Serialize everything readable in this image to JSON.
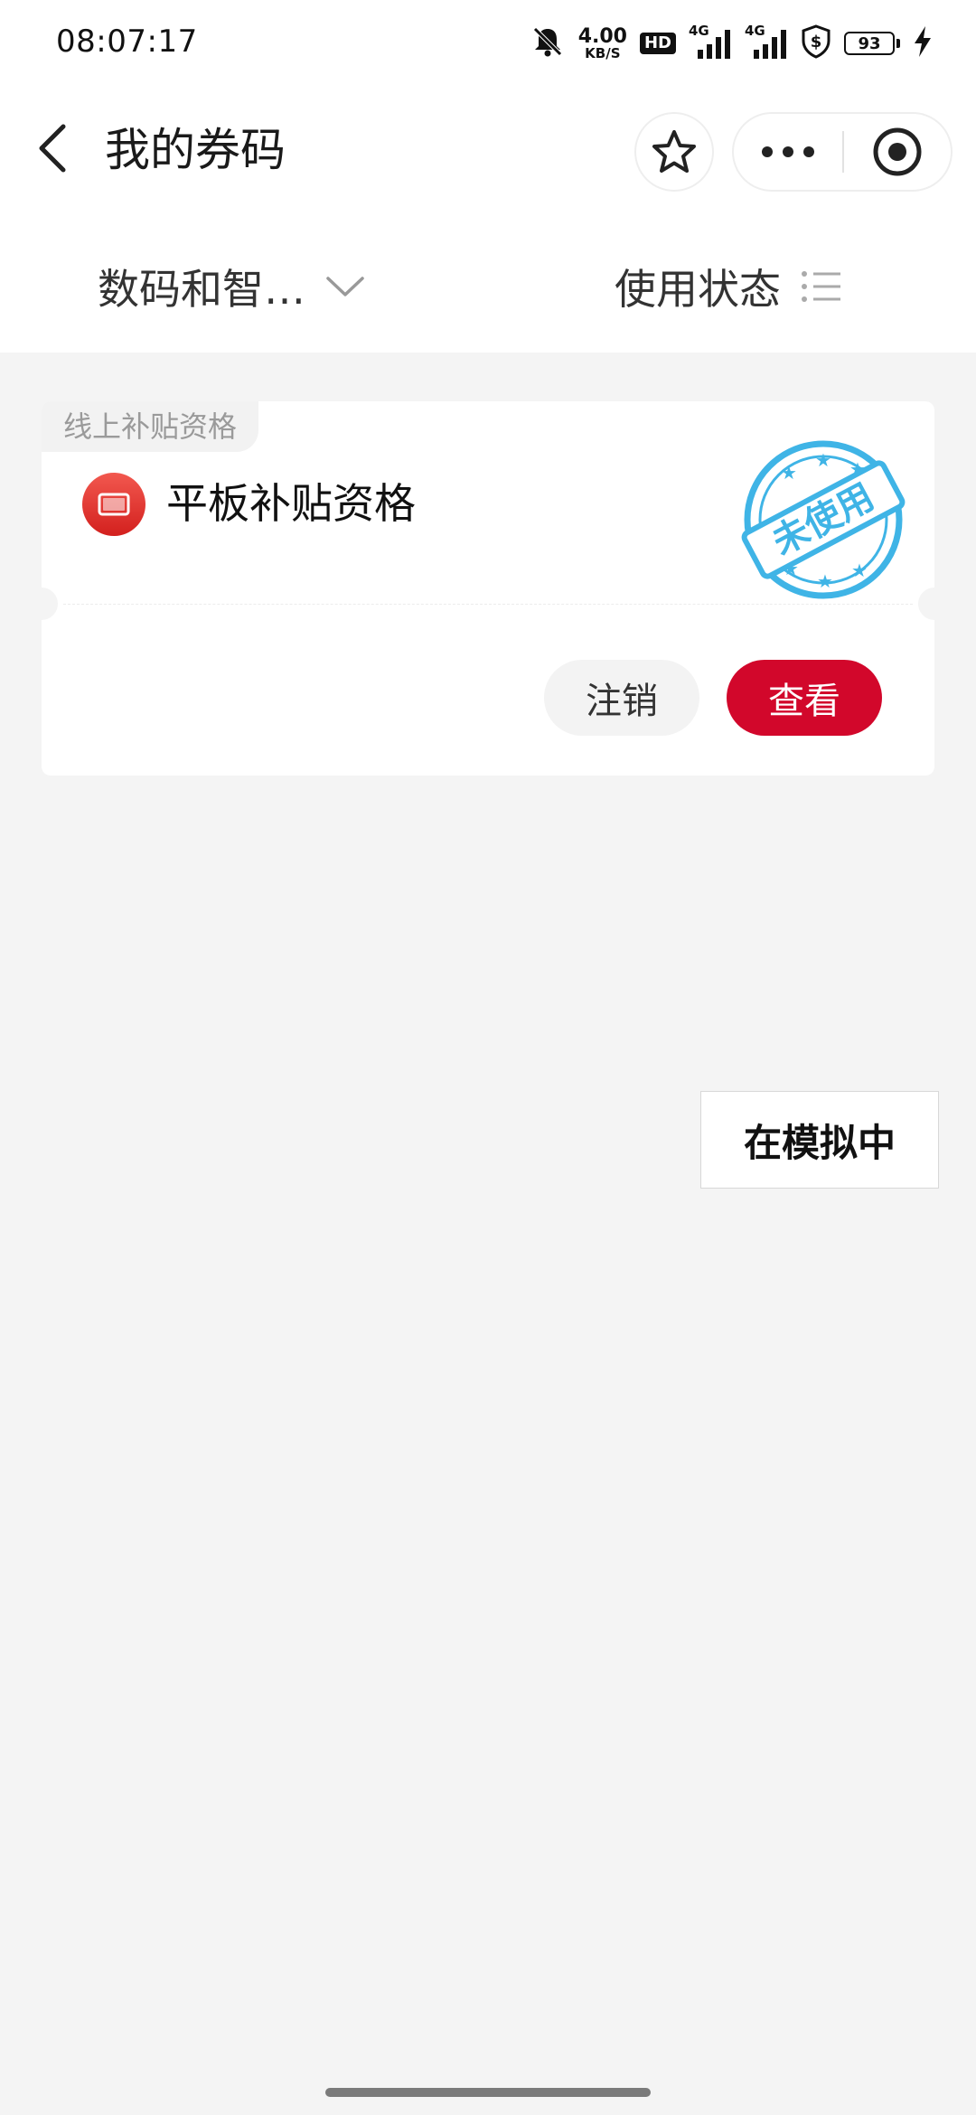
{
  "status_bar": {
    "time": "08:07:17",
    "net_speed_value": "4.00",
    "net_speed_unit": "KB/S",
    "hd_badge": "HD",
    "signal_1_label": "4G",
    "signal_2_label": "4G",
    "battery_level": "93",
    "icons": [
      "bell-muted-icon",
      "hd-icon",
      "signal-icon",
      "signal-icon",
      "shield-dollar-icon",
      "battery-icon",
      "charging-bolt-icon"
    ]
  },
  "header": {
    "title": "我的券码",
    "icons": [
      "back-arrow-icon",
      "star-icon",
      "more-dots-icon",
      "target-close-icon"
    ]
  },
  "filters": {
    "category_label": "数码和智…",
    "status_label": "使用状态"
  },
  "coupon": {
    "tag": "线上补贴资格",
    "title": "平板补贴资格",
    "stamp_text": "未使用",
    "cancel_label": "注销",
    "view_label": "查看"
  },
  "simulate_label": "在模拟中",
  "colors": {
    "accent_red": "#d2072b",
    "stamp_blue": "#3fb4e6",
    "background": "#f4f4f4"
  }
}
